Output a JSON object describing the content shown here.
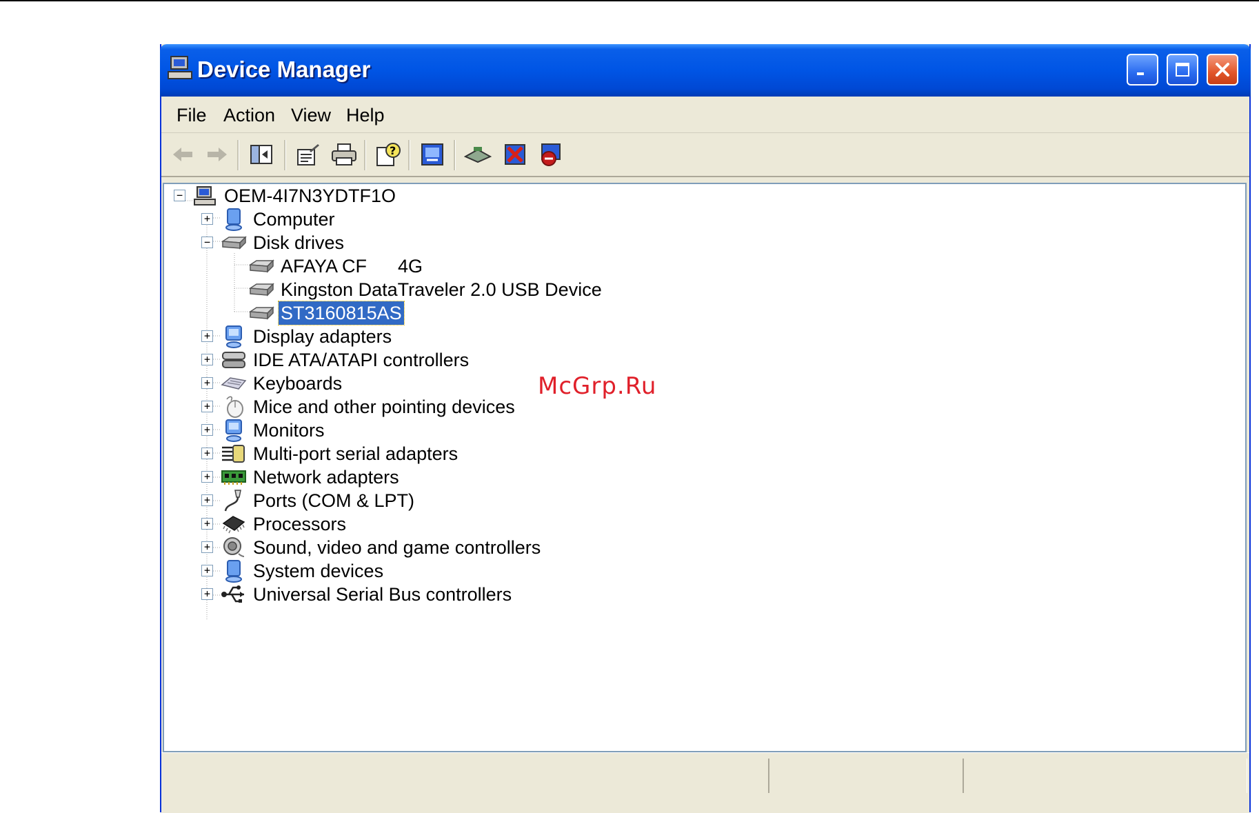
{
  "window": {
    "title": "Device Manager"
  },
  "menubar": {
    "items": [
      "File",
      "Action",
      "View",
      "Help"
    ]
  },
  "toolbar": {
    "buttons": [
      "back-icon",
      "forward-icon",
      "show-hide-tree-icon",
      "properties-icon",
      "print-icon",
      "help-icon",
      "update-driver-icon",
      "scan-hardware-icon",
      "uninstall-icon",
      "disable-icon"
    ]
  },
  "tree": {
    "root": "OEM-4I7N3YDTF1O",
    "categories": {
      "computer": "Computer",
      "disk_drives": "Disk drives",
      "display_adapters": "Display adapters",
      "ide": "IDE ATA/ATAPI controllers",
      "keyboards": "Keyboards",
      "mice": "Mice and other pointing devices",
      "monitors": "Monitors",
      "multiport": "Multi-port serial adapters",
      "network": "Network adapters",
      "ports": "Ports (COM & LPT)",
      "processors": "Processors",
      "sound": "Sound, video and game controllers",
      "system": "System devices",
      "usb": "Universal Serial Bus controllers"
    },
    "disks": [
      "AFAYA CF      4G",
      "Kingston DataTraveler 2.0 USB Device",
      "ST3160815AS"
    ],
    "selected": "ST3160815AS"
  },
  "watermark": "McGrp.Ru",
  "colors": {
    "title_blue": "#0055e5",
    "selection": "#316ac5",
    "chrome": "#ece9d8",
    "watermark": "#e0202a"
  }
}
